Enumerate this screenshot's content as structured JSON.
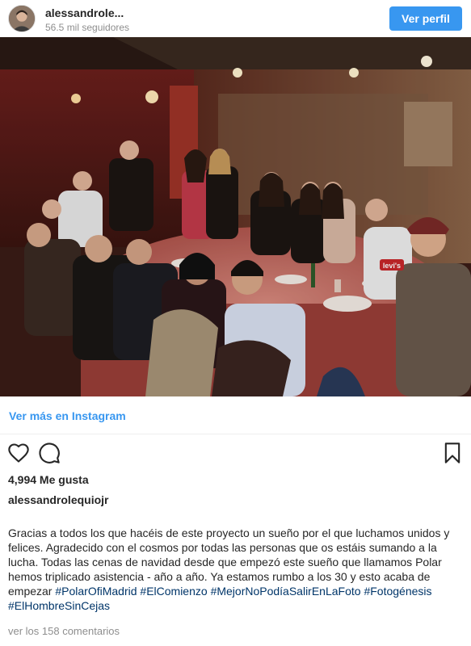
{
  "header": {
    "username": "alessandrole...",
    "followers": "56.5 mil seguidores",
    "view_profile_label": "Ver perfil"
  },
  "post": {
    "more_link": "Ver más en Instagram",
    "likes": "4,994 Me gusta",
    "caption_user": "alessandrolequiojr",
    "caption_text": "Gracias a todos los que hacéis de este proyecto un sueño por el que luchamos unidos y felices. Agradecido con el cosmos por todas las personas que os estáis sumando a la lucha. Todas las cenas de navidad desde que empezó este sueño que llamamos Polar hemos triplicado asistencia - año a año. Ya estamos rumbo a los 30 y esto acaba de empezar ",
    "hashtags": [
      "#PolarOfiMadrid",
      "#ElComienzo",
      "#MejorNoPodíaSalirEnLaFoto",
      "#Fotogénesis",
      "#ElHombreSinCejas"
    ],
    "comments_link": "ver los 158 comentarios",
    "photo_shirt_text": "levi's"
  },
  "icons": {
    "like": "heart-icon",
    "comment": "comment-bubble-icon",
    "save": "bookmark-icon"
  },
  "colors": {
    "accent": "#3897f0",
    "hashtag": "#003569",
    "muted": "#8e8e8e"
  }
}
